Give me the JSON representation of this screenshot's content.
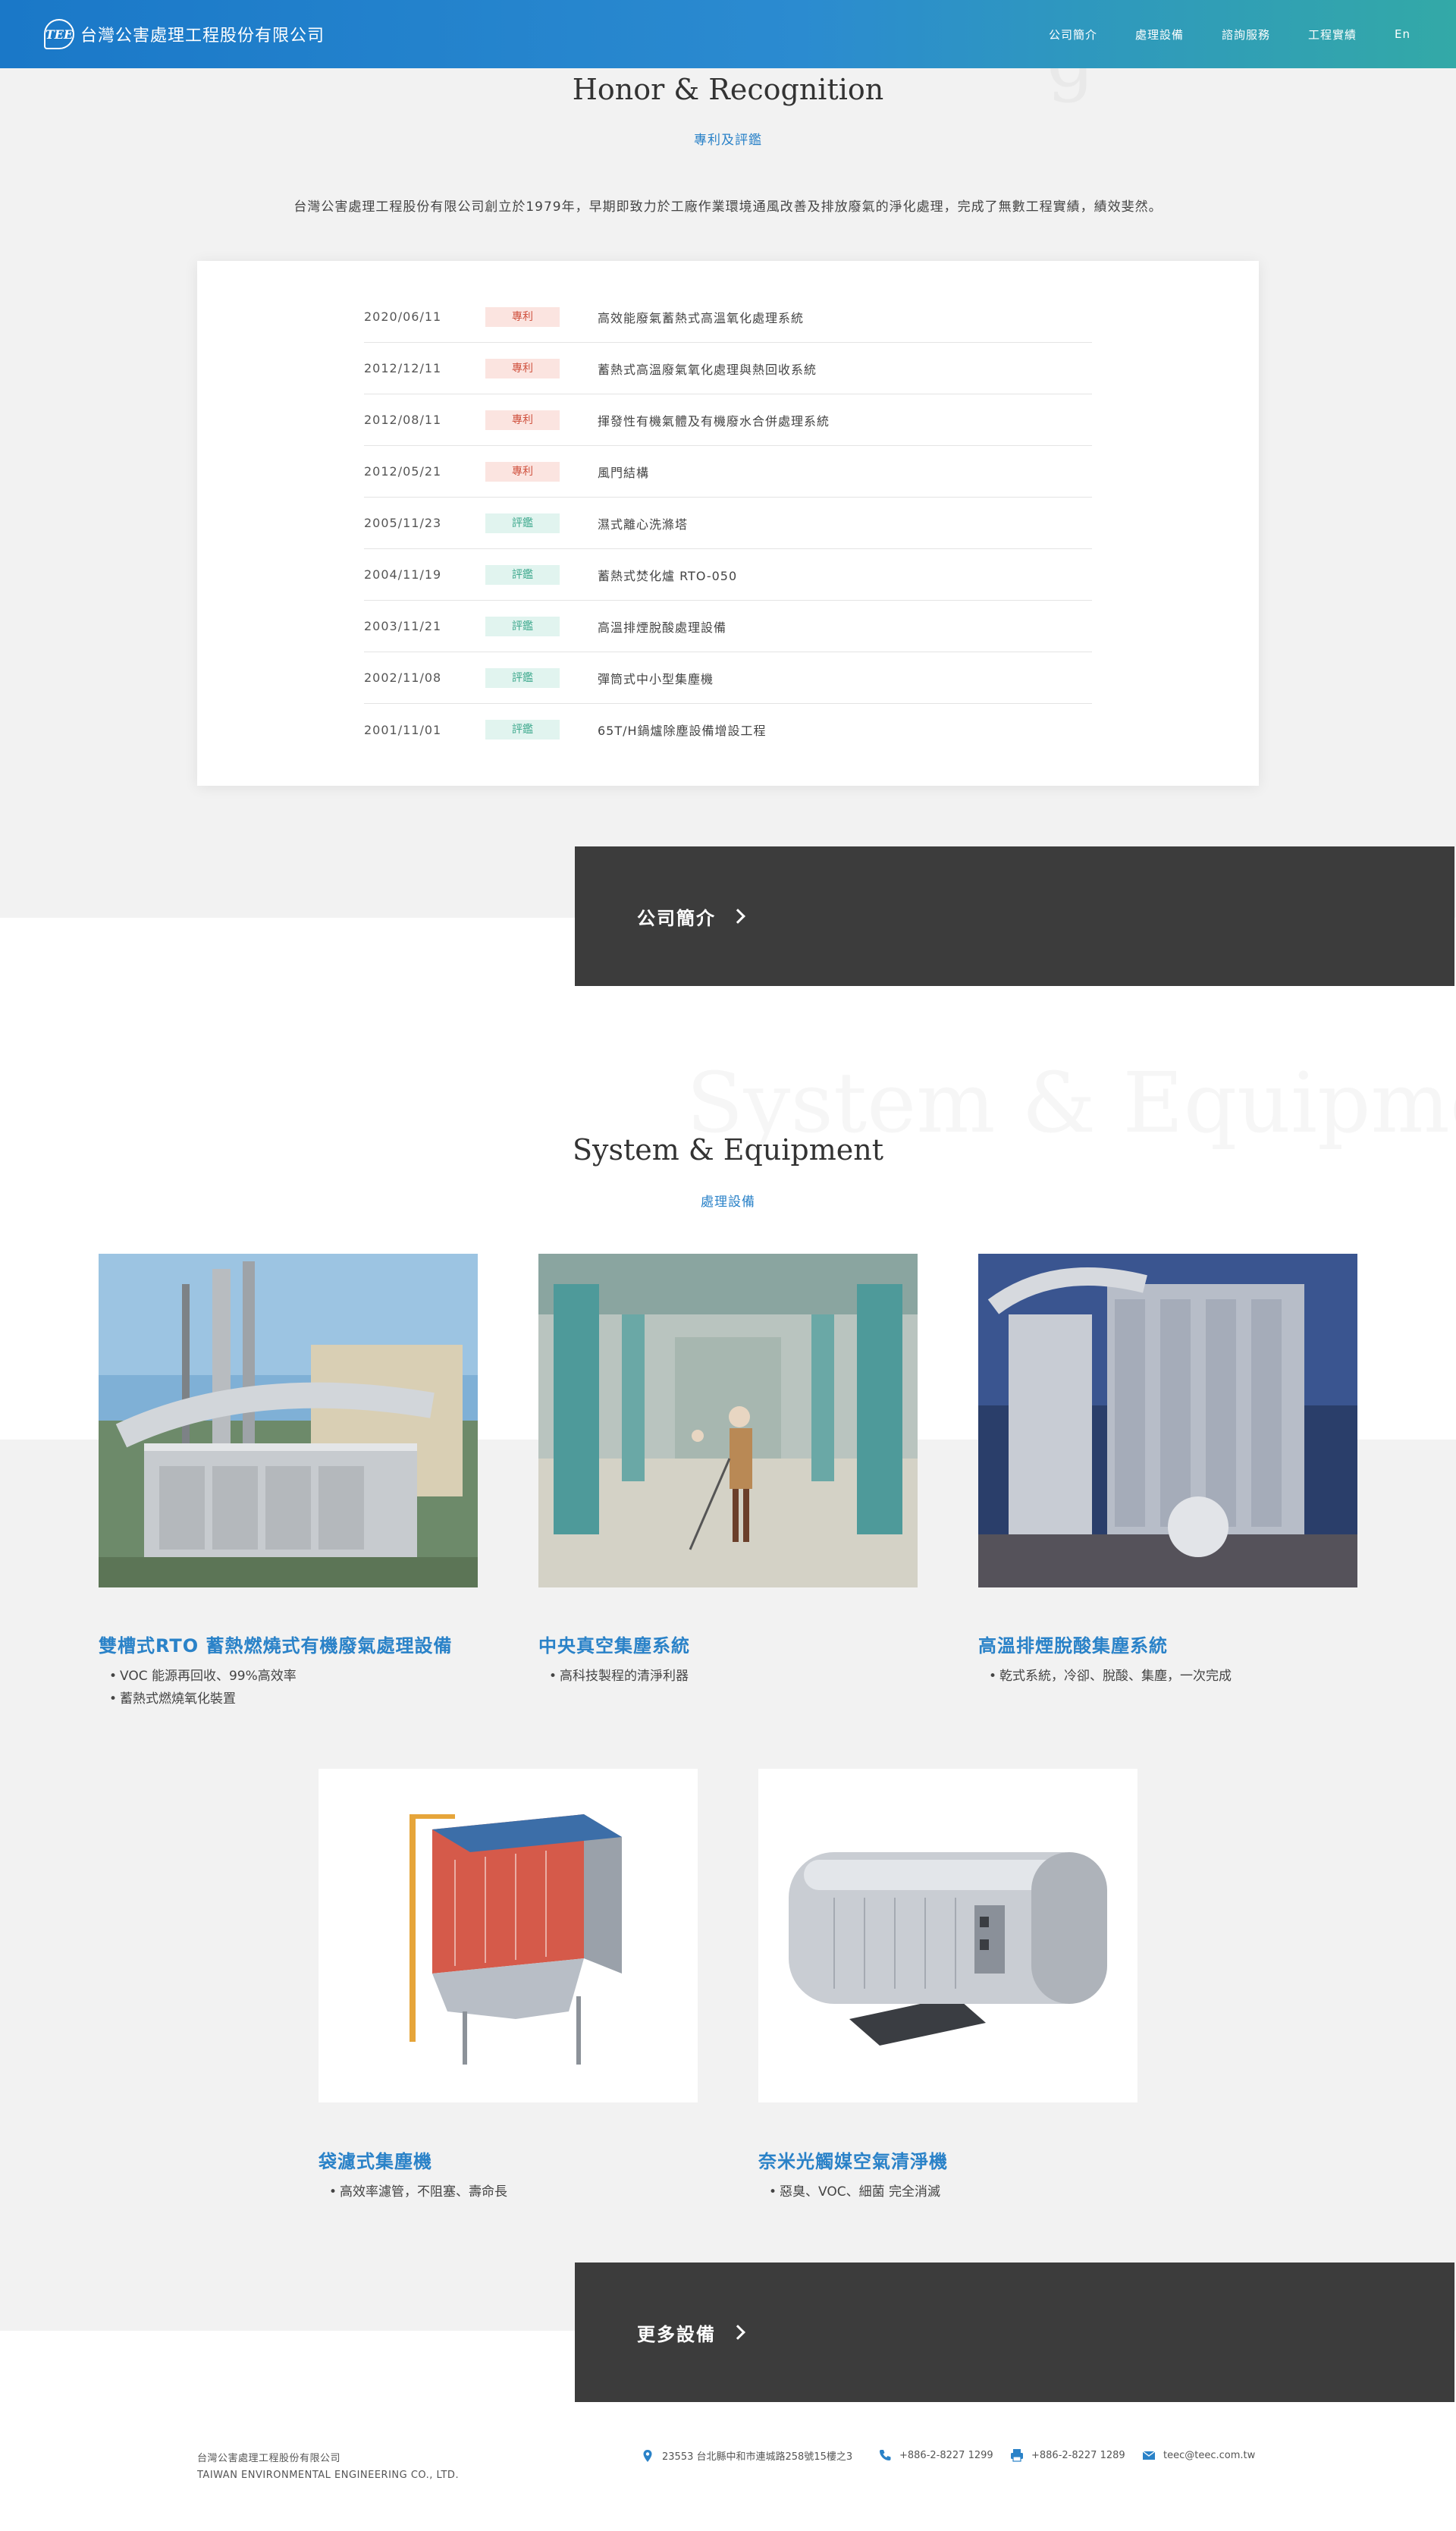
{
  "header": {
    "logo_mark": "TEE",
    "logo_text": "台灣公害處理工程股份有限公司",
    "nav": [
      "公司簡介",
      "處理設備",
      "諮詢服務",
      "工程實績",
      "En"
    ]
  },
  "honor": {
    "title": "Honor & Recognition",
    "subtitle": "專利及評鑑",
    "intro": "台灣公害處理工程股份有限公司創立於1979年，早期即致力於工廠作業環境通風改善及排放廢氣的淨化處理，完成了無數工程實績，績效斐然。",
    "items": [
      {
        "date": "2020/06/11",
        "type": "專利",
        "kind": "patent",
        "title": "高效能廢氣蓄熱式高溫氧化處理系統"
      },
      {
        "date": "2012/12/11",
        "type": "專利",
        "kind": "patent",
        "title": "蓄熱式高溫廢氣氧化處理與熱回收系統"
      },
      {
        "date": "2012/08/11",
        "type": "專利",
        "kind": "patent",
        "title": "揮發性有機氣體及有機廢水合併處理系統"
      },
      {
        "date": "2012/05/21",
        "type": "專利",
        "kind": "patent",
        "title": "風門結構"
      },
      {
        "date": "2005/11/23",
        "type": "評鑑",
        "kind": "award",
        "title": "濕式離心洗滌塔"
      },
      {
        "date": "2004/11/19",
        "type": "評鑑",
        "kind": "award",
        "title": "蓄熱式焚化爐 RTO-050"
      },
      {
        "date": "2003/11/21",
        "type": "評鑑",
        "kind": "award",
        "title": "高溫排煙脫酸處理設備"
      },
      {
        "date": "2002/11/08",
        "type": "評鑑",
        "kind": "award",
        "title": "彈筒式中小型集塵機"
      },
      {
        "date": "2001/11/01",
        "type": "評鑑",
        "kind": "award",
        "title": "65T/H鍋爐除塵設備增設工程"
      }
    ],
    "more_label": "公司簡介"
  },
  "equipment": {
    "watermark": "System & Equipment",
    "title": "System & Equipment",
    "subtitle": "處理設備",
    "items": [
      {
        "name": "雙槽式RTO 蓄熱燃燒式有機廢氣處理設備",
        "features": [
          "VOC 能源再回收、99%高效率",
          "蓄熱式燃燒氧化裝置"
        ]
      },
      {
        "name": "中央真空集塵系統",
        "features": [
          "高科技製程的清淨利器"
        ]
      },
      {
        "name": "高溫排煙脫酸集塵系統",
        "features": [
          "乾式系統，冷卻、脫酸、集塵，一次完成"
        ]
      },
      {
        "name": "袋濾式集塵機",
        "features": [
          "高效率濾管，不阻塞、壽命長"
        ]
      },
      {
        "name": "奈米光觸媒空氣清淨機",
        "features": [
          "惡臭、VOC、細菌 完全消滅"
        ]
      }
    ],
    "more_label": "更多設備"
  },
  "footer": {
    "company_zh": "台灣公害處理工程股份有限公司",
    "company_en": "TAIWAN ENVIRONMENTAL ENGINEERING CO., LTD.",
    "address": "23553 台北縣中和市連城路258號15樓之3",
    "phone": "+886-2-8227 1299",
    "fax": "+886-2-8227 1289",
    "email": "teec@teec.com.tw"
  },
  "colors": {
    "accent": "#2a82c8",
    "dark_bar": "#3c3c3c",
    "patent": "#d0523f",
    "award": "#3fa98e"
  }
}
